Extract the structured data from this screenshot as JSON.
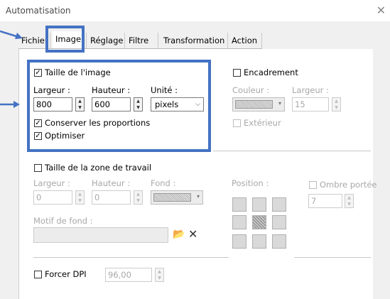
{
  "window": {
    "title": "Automatisation",
    "close_glyph": "✕"
  },
  "tabs": [
    {
      "label": "Fichier"
    },
    {
      "label": "Image"
    },
    {
      "label": "Réglage"
    },
    {
      "label": "Filtre"
    },
    {
      "label": "Transformation"
    },
    {
      "label": "Action"
    }
  ],
  "image_size": {
    "label": "Taille de l'image",
    "checked": true,
    "width_label": "Largeur :",
    "height_label": "Hauteur :",
    "unit_label": "Unité :",
    "width_value": "800",
    "height_value": "600",
    "unit_value": "pixels",
    "keep_proportions_label": "Conserver les proportions",
    "optimize_label": "Optimiser"
  },
  "frame": {
    "label": "Encadrement",
    "color_label": "Couleur :",
    "width_label": "Largeur :",
    "width_value": "15",
    "outside_label": "Extérieur"
  },
  "work_area": {
    "label": "Taille de la zone de travail",
    "width_label": "Largeur :",
    "height_label": "Hauteur :",
    "fill_label": "Fond :",
    "width_value": "0",
    "height_value": "0",
    "position_label": "Position :",
    "shadow_label": "Ombre portée",
    "shadow_value": "7",
    "pattern_label": "Motif de fond :"
  },
  "dpi": {
    "label": "Forcer DPI",
    "value": "96,00"
  },
  "colors": {
    "highlight": "#4472c4",
    "panel": "#ffffff",
    "background": "#f0f0f0"
  },
  "icons": {
    "check": "✓",
    "spin_up": "▲",
    "spin_down": "▼",
    "dropdown": "▾",
    "chevron": "⌵",
    "open_folder": "📂",
    "delete": "✕"
  }
}
